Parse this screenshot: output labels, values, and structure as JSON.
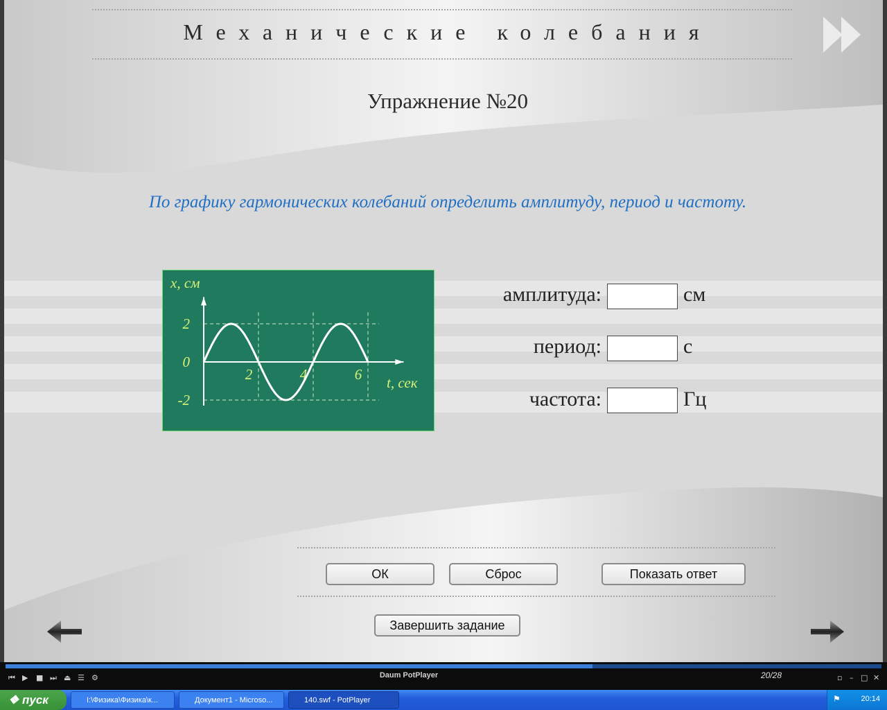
{
  "slide": {
    "course_title": "Механические колебания",
    "exercise_title": "Упражнение №20",
    "task_text": "По графику гармонических колебаний определить амплитуду, период и частоту.",
    "fields": [
      {
        "label": "амплитуда:",
        "value": "",
        "unit": "см"
      },
      {
        "label": "период:",
        "value": "",
        "unit": "с"
      },
      {
        "label": "частота:",
        "value": "",
        "unit": "Гц"
      }
    ],
    "buttons": {
      "ok": "ОК",
      "reset": "Сброс",
      "show_answer": "Показать ответ",
      "finish": "Завершить задание"
    }
  },
  "chart_data": {
    "type": "line",
    "background_color": "#1f7a5e",
    "xlabel": "t, сек",
    "ylabel": "x, см",
    "x_ticks": [
      "2",
      "4",
      "6"
    ],
    "y_ticks": [
      "2",
      "0",
      "-2"
    ],
    "xlim": [
      0,
      6.5
    ],
    "ylim": [
      -2,
      2
    ],
    "grid": "dashed",
    "series": [
      {
        "x": [
          0,
          1,
          2,
          3,
          4,
          5,
          6
        ],
        "y": [
          0,
          2,
          0,
          -2,
          0,
          2,
          0
        ]
      }
    ]
  },
  "player": {
    "title": "Daum PotPlayer",
    "counter": "20/28",
    "progress": 0.67
  },
  "taskbar": {
    "start_label": "пуск",
    "items": [
      {
        "label": "I:\\Физика\\Физика\\к..."
      },
      {
        "label": "Документ1 - Microso..."
      },
      {
        "label": "140.swf - PotPlayer"
      }
    ],
    "clock": "20:14"
  }
}
